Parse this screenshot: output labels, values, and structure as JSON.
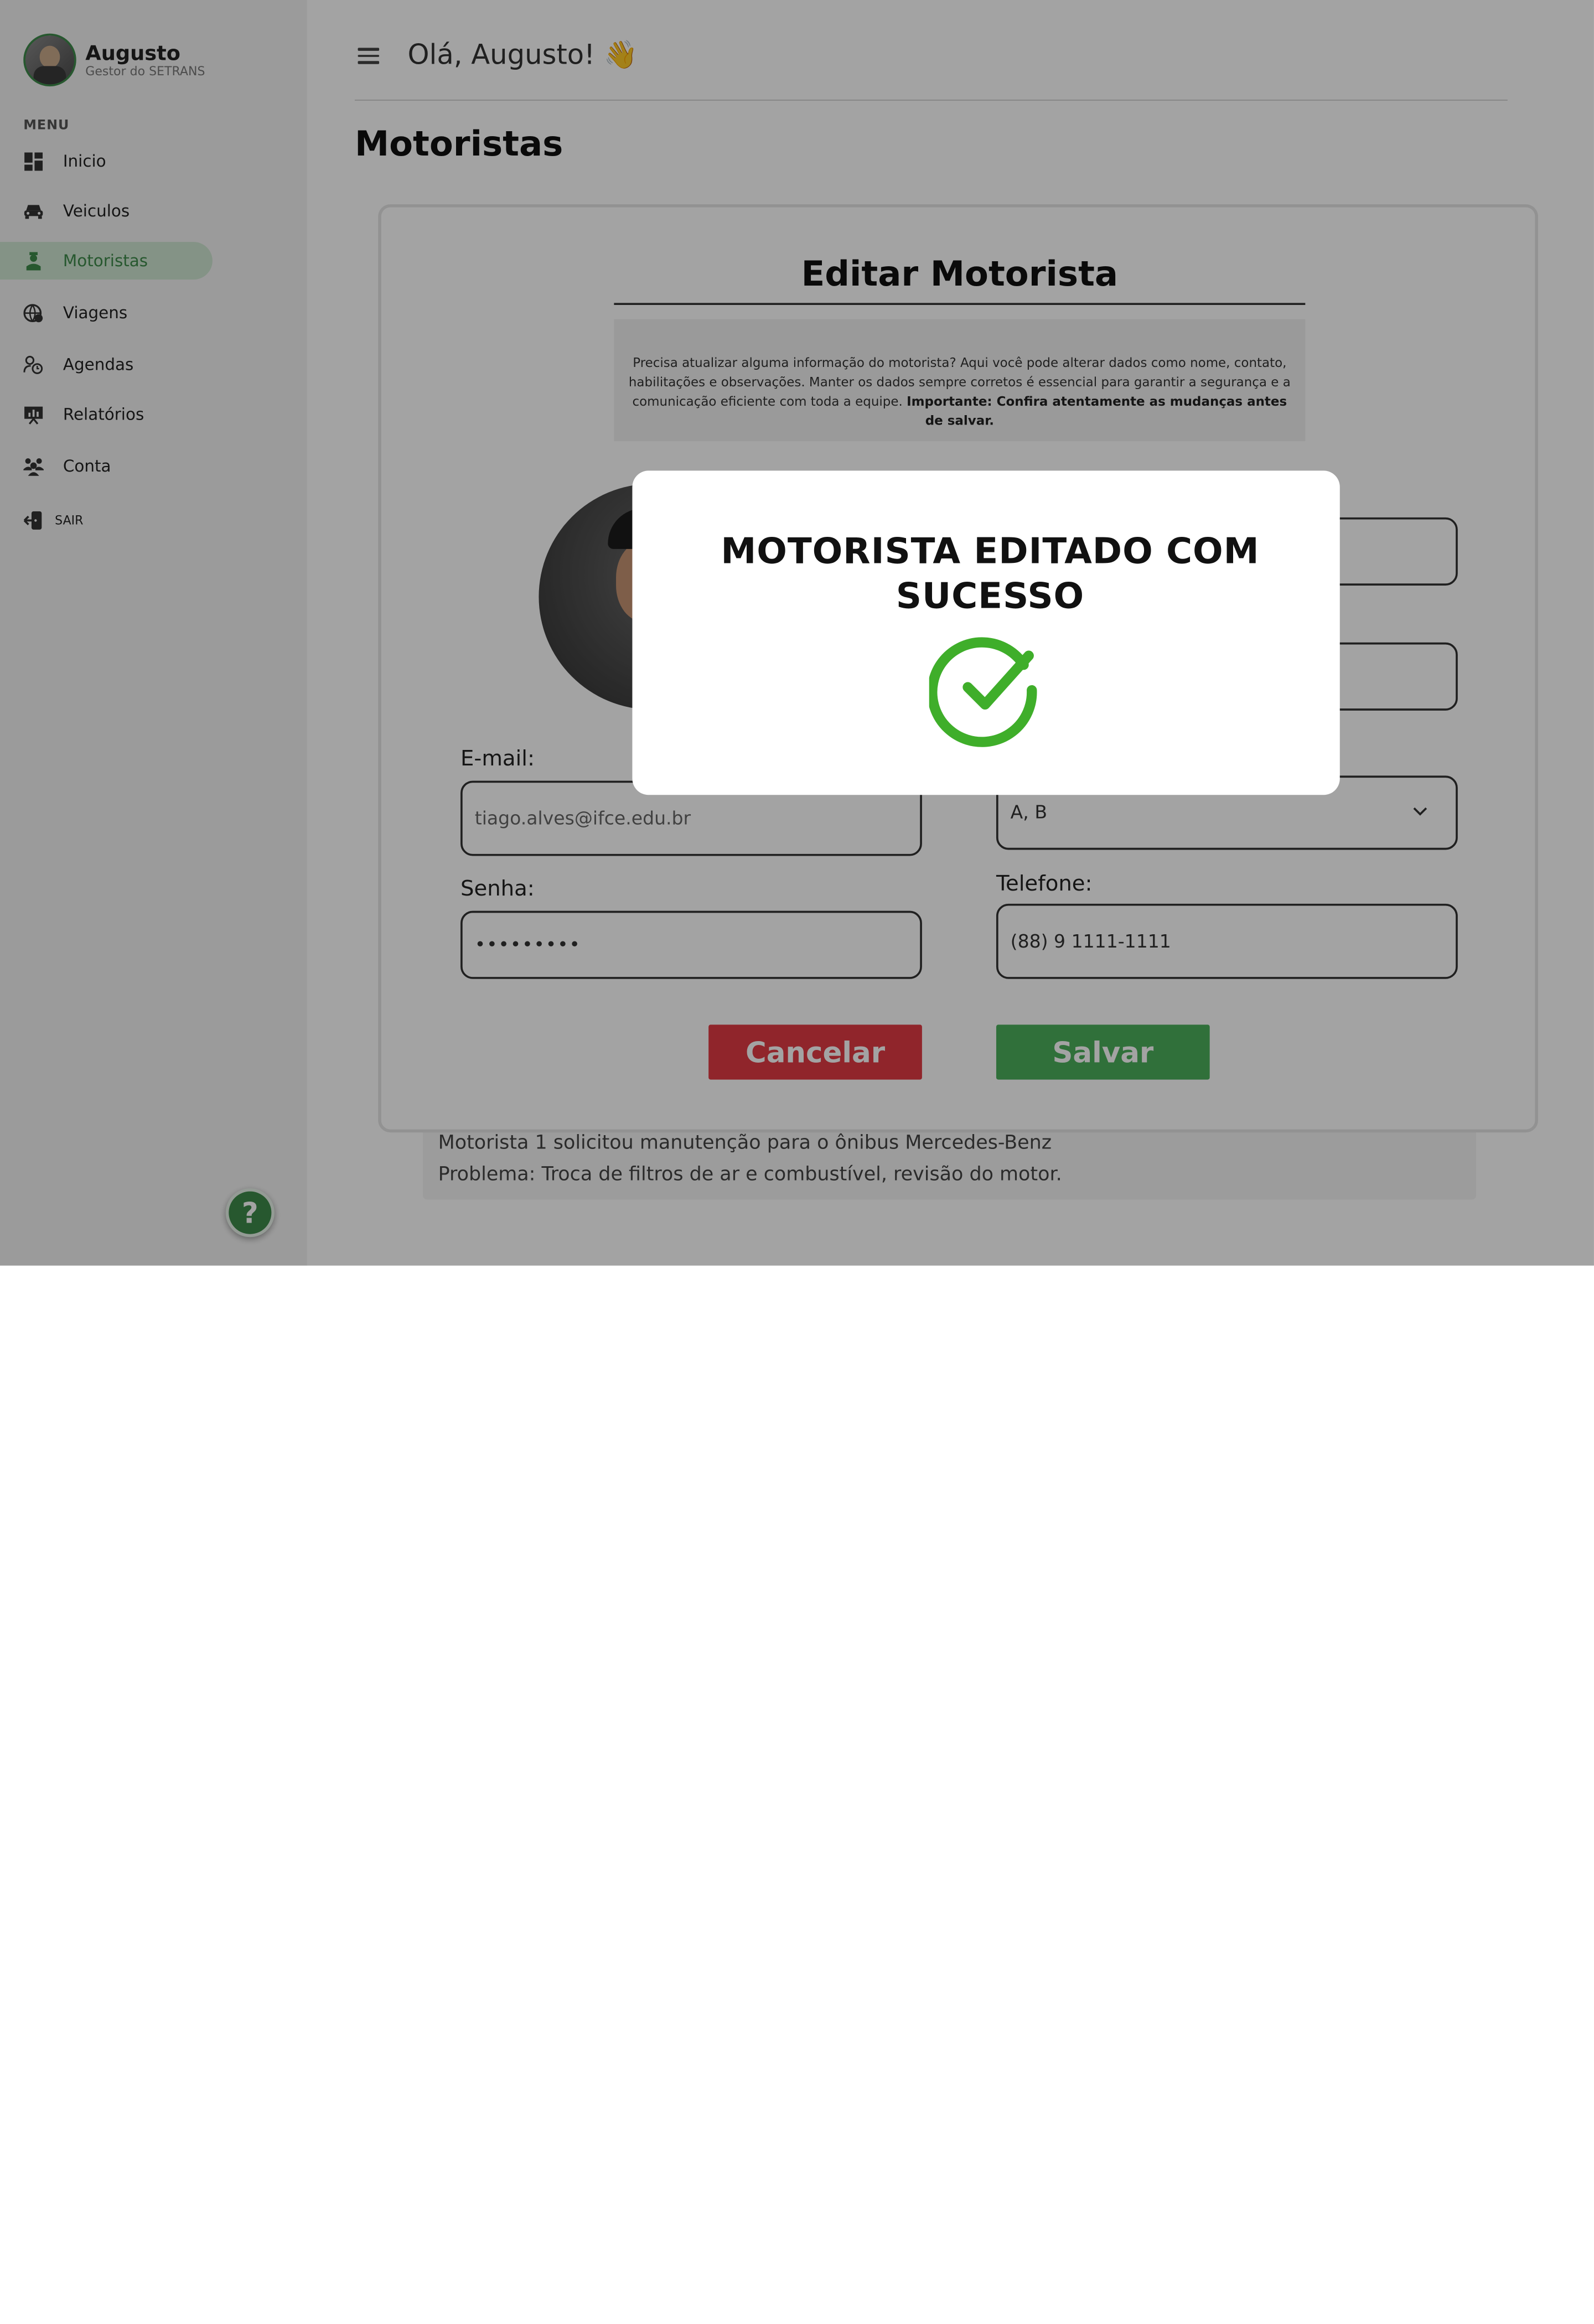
{
  "sidebar": {
    "user_name": "Augusto",
    "user_role": "Gestor do SETRANS",
    "menu_label": "MENU",
    "items": [
      {
        "label": "Inicio",
        "icon": "dashboard-icon"
      },
      {
        "label": "Veiculos",
        "icon": "car-icon"
      },
      {
        "label": "Motoristas",
        "icon": "driver-icon",
        "active": true
      },
      {
        "label": "Viagens",
        "icon": "globe-icon"
      },
      {
        "label": "Agendas",
        "icon": "schedule-icon"
      },
      {
        "label": "Relatórios",
        "icon": "report-icon"
      },
      {
        "label": "Conta",
        "icon": "users-icon"
      }
    ],
    "logout_label": "SAIR",
    "help_label": "?"
  },
  "header": {
    "greeting": "Olá, Augusto! 👋",
    "page_title": "Motoristas"
  },
  "form": {
    "title": "Editar Motorista",
    "info_text": "Precisa atualizar alguma informação do motorista? Aqui você pode alterar dados como nome, contato, habilitações e observações. Manter os dados sempre corretos é essencial para garantir a segurança e a comunicação eficiente com toda a equipe.",
    "info_bold": "Importante: Confira atentamente as mudanças antes de salvar.",
    "email_label": "E-mail:",
    "email_value": "tiago.alves@ifce.edu.br",
    "password_label": "Senha:",
    "password_value": "•••••••••",
    "license_value": "A, B",
    "phone_label": "Telefone:",
    "phone_value": "(88) 9 1111-1111",
    "cancel_label": "Cancelar",
    "save_label": "Salvar"
  },
  "notice": {
    "line1": "Motorista 1 solicitou manutenção para o ônibus Mercedes-Benz",
    "line2": "Problema: Troca de filtros de ar e combustível, revisão do motor."
  },
  "modal": {
    "title_line1": "MOTORISTA EDITADO COM",
    "title_line2": "SUCESSO",
    "icon": "success-check-icon"
  },
  "colors": {
    "accent_green": "#3d8a4a",
    "active_bg": "#cfe6d2",
    "cancel_red": "#e23b44",
    "save_green": "#4caf5c",
    "check_green": "#3fae2a"
  }
}
